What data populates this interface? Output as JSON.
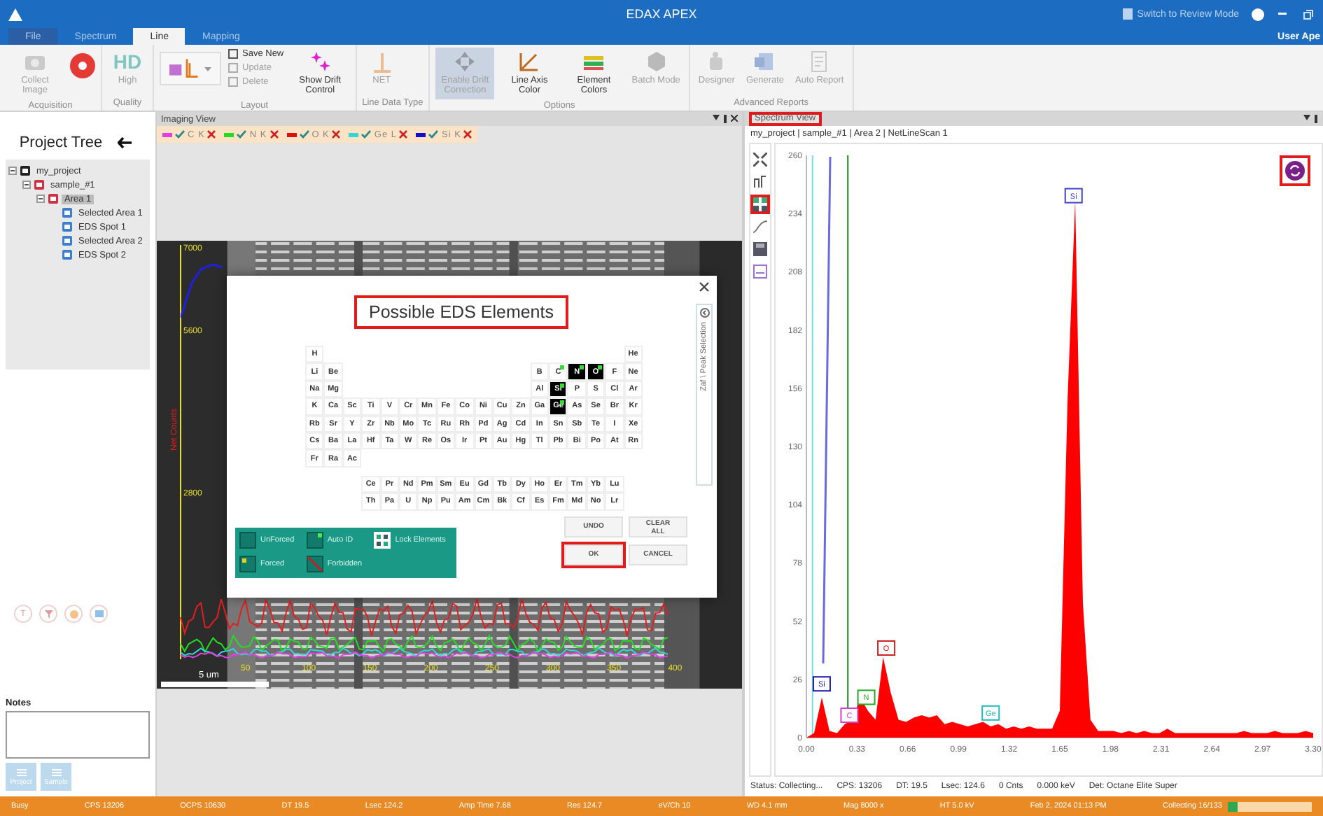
{
  "window": {
    "title": "EDAX APEX",
    "review_mode": "Switch to Review Mode",
    "user": "User Ape"
  },
  "menu_tabs": [
    {
      "label": "File",
      "selected": false
    },
    {
      "label": "Spectrum",
      "selected": false
    },
    {
      "label": "Line",
      "selected": true
    },
    {
      "label": "Mapping",
      "selected": false
    }
  ],
  "ribbon": [
    {
      "label": "Acquisition",
      "buttons": [
        {
          "kind": "large",
          "label": "Collect Image",
          "disabled": true,
          "pressed": false
        },
        {
          "kind": "record",
          "disabled": false,
          "pressed": false
        }
      ]
    },
    {
      "label": "Quality",
      "buttons": [
        {
          "kind": "hd",
          "badge": "HD",
          "label": "High",
          "disabled": true,
          "pressed": false
        }
      ]
    },
    {
      "label": "Layout",
      "buttons": [
        {
          "kind": "picker",
          "disabled": false,
          "pressed": false
        },
        {
          "kind": "small",
          "label": "Save New",
          "disabled": false,
          "pressed": false
        },
        {
          "kind": "small",
          "label": "Update",
          "disabled": true,
          "pressed": false
        },
        {
          "kind": "small",
          "label": "Delete",
          "disabled": true,
          "pressed": false
        },
        {
          "kind": "large",
          "label": "Show Drift Control",
          "disabled": false,
          "pressed": false
        }
      ]
    },
    {
      "label": "Line Data Type",
      "buttons": [
        {
          "kind": "large",
          "label": "NET",
          "disabled": true,
          "pressed": false
        }
      ]
    },
    {
      "label": "Options",
      "buttons": [
        {
          "kind": "large",
          "label": "Enable Drift Correction",
          "disabled": true,
          "pressed": true
        },
        {
          "kind": "large",
          "label": "Line Axis Color",
          "disabled": false,
          "pressed": false
        },
        {
          "kind": "large",
          "label": "Element Colors",
          "disabled": false,
          "pressed": false
        },
        {
          "kind": "large",
          "label": "Batch Mode",
          "disabled": true,
          "pressed": false
        }
      ]
    },
    {
      "label": "Advanced Reports",
      "buttons": [
        {
          "kind": "large",
          "label": "Designer",
          "disabled": true,
          "pressed": false
        },
        {
          "kind": "large",
          "label": "Generate",
          "disabled": true,
          "pressed": false
        },
        {
          "kind": "large",
          "label": "Auto Report",
          "disabled": true,
          "pressed": false
        }
      ]
    }
  ],
  "project_tree": {
    "title": "Project Tree",
    "items": [
      {
        "label": "my_project",
        "expanded": true,
        "selected": false,
        "children": [
          {
            "label": "sample_#1",
            "expanded": true,
            "selected": false,
            "children": [
              {
                "label": "Area 1",
                "expanded": true,
                "selected": true,
                "children": [
                  {
                    "label": "Selected Area 1",
                    "selected": false
                  },
                  {
                    "label": "EDS Spot 1",
                    "selected": false
                  },
                  {
                    "label": "Selected Area 2",
                    "selected": false
                  },
                  {
                    "label": "EDS Spot 2",
                    "selected": false
                  }
                ]
              }
            ]
          }
        ]
      }
    ]
  },
  "quick_tools": [
    {
      "kind": "text",
      "label": "T"
    },
    {
      "kind": "filter"
    },
    {
      "kind": "palette"
    },
    {
      "kind": "chat"
    }
  ],
  "notes": {
    "label": "Notes",
    "buttons": [
      {
        "label": "Project",
        "disabled": true
      },
      {
        "label": "Sample",
        "disabled": true
      }
    ]
  },
  "imaging_view": {
    "title": "Imaging View",
    "legend": [
      {
        "label": "C K",
        "color": "#e040e0",
        "checked": true
      },
      {
        "label": "N K",
        "color": "#22dd22",
        "checked": true
      },
      {
        "label": "O K",
        "color": "#dd1111",
        "checked": true
      },
      {
        "label": "Ge L",
        "color": "#33d6d6",
        "checked": true
      },
      {
        "label": "Si K",
        "color": "#1010cc",
        "checked": true
      }
    ],
    "profile": {
      "y_labels": [
        "7000",
        "5600",
        "2800"
      ],
      "y_title": "Net Counts",
      "x_labels": [
        "50",
        "100",
        "150",
        "200",
        "250",
        "300",
        "350",
        "400"
      ],
      "scale_bar": "5 um"
    }
  },
  "dialog": {
    "title": "Possible EDS Elements",
    "title_highlighted": true,
    "side_tab": "Zaf \\ Peak Selection",
    "rows": [
      [
        {
          "symbol": "H",
          "selected": false,
          "auto_id": false
        },
        "",
        "",
        "",
        "",
        "",
        "",
        "",
        "",
        "",
        "",
        "",
        "",
        "",
        "",
        "",
        "",
        {
          "symbol": "He",
          "selected": false,
          "auto_id": false
        }
      ],
      [
        {
          "symbol": "Li",
          "selected": false,
          "auto_id": false
        },
        {
          "symbol": "Be",
          "selected": false,
          "auto_id": false
        },
        "",
        "",
        "",
        "",
        "",
        "",
        "",
        "",
        "",
        "",
        {
          "symbol": "B",
          "selected": false,
          "auto_id": false
        },
        {
          "symbol": "C",
          "selected": false,
          "auto_id": true
        },
        {
          "symbol": "N",
          "selected": true,
          "auto_id": true
        },
        {
          "symbol": "O",
          "selected": true,
          "auto_id": true
        },
        {
          "symbol": "F",
          "selected": false,
          "auto_id": false
        },
        {
          "symbol": "Ne",
          "selected": false,
          "auto_id": false
        }
      ],
      [
        {
          "symbol": "Na",
          "selected": false,
          "auto_id": false
        },
        {
          "symbol": "Mg",
          "selected": false,
          "auto_id": false
        },
        "",
        "",
        "",
        "",
        "",
        "",
        "",
        "",
        "",
        "",
        {
          "symbol": "Al",
          "selected": false,
          "auto_id": false
        },
        {
          "symbol": "Si",
          "selected": true,
          "auto_id": true
        },
        {
          "symbol": "P",
          "selected": false,
          "auto_id": false
        },
        {
          "symbol": "S",
          "selected": false,
          "auto_id": false
        },
        {
          "symbol": "Cl",
          "selected": false,
          "auto_id": false
        },
        {
          "symbol": "Ar",
          "selected": false,
          "auto_id": false
        }
      ],
      [
        {
          "symbol": "K",
          "selected": false,
          "auto_id": false
        },
        {
          "symbol": "Ca",
          "selected": false,
          "auto_id": false
        },
        {
          "symbol": "Sc",
          "selected": false,
          "auto_id": false
        },
        {
          "symbol": "Ti",
          "selected": false,
          "auto_id": false
        },
        {
          "symbol": "V",
          "selected": false,
          "auto_id": false
        },
        {
          "symbol": "Cr",
          "selected": false,
          "auto_id": false
        },
        {
          "symbol": "Mn",
          "selected": false,
          "auto_id": false
        },
        {
          "symbol": "Fe",
          "selected": false,
          "auto_id": false
        },
        {
          "symbol": "Co",
          "selected": false,
          "auto_id": false
        },
        {
          "symbol": "Ni",
          "selected": false,
          "auto_id": false
        },
        {
          "symbol": "Cu",
          "selected": false,
          "auto_id": false
        },
        {
          "symbol": "Zn",
          "selected": false,
          "auto_id": false
        },
        {
          "symbol": "Ga",
          "selected": false,
          "auto_id": false
        },
        {
          "symbol": "Ge",
          "selected": true,
          "auto_id": true
        },
        {
          "symbol": "As",
          "selected": false,
          "auto_id": false
        },
        {
          "symbol": "Se",
          "selected": false,
          "auto_id": false
        },
        {
          "symbol": "Br",
          "selected": false,
          "auto_id": false
        },
        {
          "symbol": "Kr",
          "selected": false,
          "auto_id": false
        }
      ],
      [
        {
          "symbol": "Rb",
          "selected": false,
          "auto_id": false
        },
        {
          "symbol": "Sr",
          "selected": false,
          "auto_id": false
        },
        {
          "symbol": "Y",
          "selected": false,
          "auto_id": false
        },
        {
          "symbol": "Zr",
          "selected": false,
          "auto_id": false
        },
        {
          "symbol": "Nb",
          "selected": false,
          "auto_id": false
        },
        {
          "symbol": "Mo",
          "selected": false,
          "auto_id": false
        },
        {
          "symbol": "Tc",
          "selected": false,
          "auto_id": false
        },
        {
          "symbol": "Ru",
          "selected": false,
          "auto_id": false
        },
        {
          "symbol": "Rh",
          "selected": false,
          "auto_id": false
        },
        {
          "symbol": "Pd",
          "selected": false,
          "auto_id": false
        },
        {
          "symbol": "Ag",
          "selected": false,
          "auto_id": false
        },
        {
          "symbol": "Cd",
          "selected": false,
          "auto_id": false
        },
        {
          "symbol": "In",
          "selected": false,
          "auto_id": false
        },
        {
          "symbol": "Sn",
          "selected": false,
          "auto_id": false
        },
        {
          "symbol": "Sb",
          "selected": false,
          "auto_id": false
        },
        {
          "symbol": "Te",
          "selected": false,
          "auto_id": false
        },
        {
          "symbol": "I",
          "selected": false,
          "auto_id": false
        },
        {
          "symbol": "Xe",
          "selected": false,
          "auto_id": false
        }
      ],
      [
        {
          "symbol": "Cs",
          "selected": false,
          "auto_id": false
        },
        {
          "symbol": "Ba",
          "selected": false,
          "auto_id": false
        },
        {
          "symbol": "La",
          "selected": false,
          "auto_id": false
        },
        {
          "symbol": "Hf",
          "selected": false,
          "auto_id": false
        },
        {
          "symbol": "Ta",
          "selected": false,
          "auto_id": false
        },
        {
          "symbol": "W",
          "selected": false,
          "auto_id": false
        },
        {
          "symbol": "Re",
          "selected": false,
          "auto_id": false
        },
        {
          "symbol": "Os",
          "selected": false,
          "auto_id": false
        },
        {
          "symbol": "Ir",
          "selected": false,
          "auto_id": false
        },
        {
          "symbol": "Pt",
          "selected": false,
          "auto_id": false
        },
        {
          "symbol": "Au",
          "selected": false,
          "auto_id": false
        },
        {
          "symbol": "Hg",
          "selected": false,
          "auto_id": false
        },
        {
          "symbol": "Tl",
          "selected": false,
          "auto_id": false
        },
        {
          "symbol": "Pb",
          "selected": false,
          "auto_id": false
        },
        {
          "symbol": "Bi",
          "selected": false,
          "auto_id": false
        },
        {
          "symbol": "Po",
          "selected": false,
          "auto_id": false
        },
        {
          "symbol": "At",
          "selected": false,
          "auto_id": false
        },
        {
          "symbol": "Rn",
          "selected": false,
          "auto_id": false
        }
      ],
      [
        {
          "symbol": "Fr",
          "selected": false,
          "auto_id": false
        },
        {
          "symbol": "Ra",
          "selected": false,
          "auto_id": false
        },
        {
          "symbol": "Ac",
          "selected": false,
          "auto_id": false
        }
      ]
    ],
    "f_rows": [
      [
        "",
        "",
        "",
        {
          "symbol": "Ce",
          "selected": false,
          "auto_id": false
        },
        {
          "symbol": "Pr",
          "selected": false,
          "auto_id": false
        },
        {
          "symbol": "Nd",
          "selected": false,
          "auto_id": false
        },
        {
          "symbol": "Pm",
          "selected": false,
          "auto_id": false
        },
        {
          "symbol": "Sm",
          "selected": false,
          "auto_id": false
        },
        {
          "symbol": "Eu",
          "selected": false,
          "auto_id": false
        },
        {
          "symbol": "Gd",
          "selected": false,
          "auto_id": false
        },
        {
          "symbol": "Tb",
          "selected": false,
          "auto_id": false
        },
        {
          "symbol": "Dy",
          "selected": false,
          "auto_id": false
        },
        {
          "symbol": "Ho",
          "selected": false,
          "auto_id": false
        },
        {
          "symbol": "Er",
          "selected": false,
          "auto_id": false
        },
        {
          "symbol": "Tm",
          "selected": false,
          "auto_id": false
        },
        {
          "symbol": "Yb",
          "selected": false,
          "auto_id": false
        },
        {
          "symbol": "Lu",
          "selected": false,
          "auto_id": false
        }
      ],
      [
        "",
        "",
        "",
        {
          "symbol": "Th",
          "selected": false,
          "auto_id": false
        },
        {
          "symbol": "Pa",
          "selected": false,
          "auto_id": false
        },
        {
          "symbol": "U",
          "selected": false,
          "auto_id": false
        },
        {
          "symbol": "Np",
          "selected": false,
          "auto_id": false
        },
        {
          "symbol": "Pu",
          "selected": false,
          "auto_id": false
        },
        {
          "symbol": "Am",
          "selected": false,
          "auto_id": false
        },
        {
          "symbol": "Cm",
          "selected": false,
          "auto_id": false
        },
        {
          "symbol": "Bk",
          "selected": false,
          "auto_id": false
        },
        {
          "symbol": "Cf",
          "selected": false,
          "auto_id": false
        },
        {
          "symbol": "Es",
          "selected": false,
          "auto_id": false
        },
        {
          "symbol": "Fm",
          "selected": false,
          "auto_id": false
        },
        {
          "symbol": "Md",
          "selected": false,
          "auto_id": false
        },
        {
          "symbol": "No",
          "selected": false,
          "auto_id": false
        },
        {
          "symbol": "Lr",
          "selected": false,
          "auto_id": false
        }
      ]
    ],
    "legend": [
      {
        "kind": "unforced",
        "label": "UnForced"
      },
      {
        "kind": "auto",
        "label": "Auto ID"
      },
      {
        "kind": "lock",
        "label": "Lock Elements"
      },
      {
        "kind": "forced",
        "label": "Forced"
      },
      {
        "kind": "forbidden",
        "label": "Forbidden"
      }
    ],
    "buttons": [
      {
        "label": "UNDO",
        "highlighted": false
      },
      {
        "label": "CLEAR ALL",
        "highlighted": false
      },
      {
        "label": "OK",
        "highlighted": true
      },
      {
        "label": "CANCEL",
        "highlighted": false
      }
    ]
  },
  "spectrum_view": {
    "title": "Spectrum View",
    "title_highlighted": true,
    "breadcrumb": "my_project | sample_#1 | Area 2 | NetLineScan 1",
    "tools": [
      {
        "highlighted": false
      },
      {
        "highlighted": false
      },
      {
        "highlighted": true
      },
      {
        "highlighted": false
      },
      {
        "highlighted": false
      },
      {
        "highlighted": false
      }
    ],
    "refresh_highlighted": true,
    "chart_data": {
      "type": "area",
      "xlim": [
        0,
        3.3
      ],
      "ylim": [
        0,
        260
      ],
      "xticks": [
        {
          "value": 0,
          "label": "0.00"
        },
        {
          "value": 0.33,
          "label": "0.33"
        },
        {
          "value": 0.66,
          "label": "0.66"
        },
        {
          "value": 0.99,
          "label": "0.99"
        },
        {
          "value": 1.32,
          "label": "1.32"
        },
        {
          "value": 1.65,
          "label": "1.65"
        },
        {
          "value": 1.98,
          "label": "1.98"
        },
        {
          "value": 2.31,
          "label": "2.31"
        },
        {
          "value": 2.64,
          "label": "2.64"
        },
        {
          "value": 2.97,
          "label": "2.97"
        },
        {
          "value": 3.3,
          "label": "3.30"
        }
      ],
      "yticks": [
        0,
        26,
        52,
        78,
        104,
        130,
        156,
        182,
        208,
        234,
        260
      ],
      "x": [
        0,
        0.05,
        0.1,
        0.15,
        0.2,
        0.25,
        0.3,
        0.35,
        0.4,
        0.45,
        0.5,
        0.55,
        0.6,
        0.65,
        0.7,
        0.75,
        0.8,
        0.85,
        0.9,
        0.95,
        1,
        1.05,
        1.1,
        1.15,
        1.2,
        1.25,
        1.3,
        1.35,
        1.4,
        1.45,
        1.5,
        1.55,
        1.6,
        1.65,
        1.7,
        1.75,
        1.8,
        1.85,
        1.9,
        1.95,
        2,
        2.05,
        2.1,
        2.15,
        2.2,
        2.25,
        2.3,
        2.35,
        2.4,
        2.45,
        2.5,
        2.55,
        2.6,
        2.65,
        2.7,
        2.75,
        2.8,
        2.85,
        2.9,
        2.95,
        3,
        3.05,
        3.1,
        3.15,
        3.2,
        3.25,
        3.3
      ],
      "series": [
        {
          "color": "#ff0000",
          "values": [
            0,
            2,
            18,
            3,
            2,
            6,
            8,
            18,
            12,
            8,
            36,
            20,
            8,
            7,
            9,
            10,
            9,
            10,
            6,
            7,
            6,
            5,
            6,
            7,
            5,
            6,
            4,
            5,
            4,
            5,
            4,
            4,
            4,
            12,
            150,
            240,
            60,
            8,
            3,
            3,
            3,
            2,
            3,
            2,
            3,
            2,
            2,
            4,
            2,
            2,
            2,
            2,
            2,
            2,
            2,
            2,
            2,
            3,
            2,
            2,
            2,
            3,
            2,
            2,
            2,
            3,
            2
          ]
        }
      ],
      "ref_lines": [
        {
          "axis": "x",
          "value": 0.04,
          "color": "#6ee0e0"
        },
        {
          "axis": "x",
          "value": 0.27,
          "color": "#1a8a1a"
        }
      ],
      "annotations": [
        {
          "x": 0.1,
          "y": 24,
          "text": "Si"
        },
        {
          "x": 0.28,
          "y": 10,
          "text": "C"
        },
        {
          "x": 0.39,
          "y": 18,
          "text": "N"
        },
        {
          "x": 0.52,
          "y": 40,
          "text": "O"
        },
        {
          "x": 1.2,
          "y": 11,
          "text": "Ge"
        },
        {
          "x": 1.74,
          "y": 242,
          "text": "Si"
        }
      ]
    },
    "status": [
      "Status: Collecting...",
      "CPS: 13206",
      "DT: 19.5",
      "Lsec: 124.6",
      "0 Cnts",
      "0.000 keV",
      "Det: Octane Elite Super"
    ]
  },
  "status_bar": {
    "items": [
      "Busy",
      "CPS 13206",
      "OCPS 10630",
      "DT 19.5",
      "Lsec 124.2",
      "Amp Time 7.68",
      "Res 124.7",
      "eV/Ch 10",
      "WD 4.1 mm",
      "Mag 8000 x",
      "HT 5.0 kV",
      "Feb 2, 2024 01:13 PM"
    ],
    "progress_label": "Collecting 16/133",
    "level": 0.12
  }
}
